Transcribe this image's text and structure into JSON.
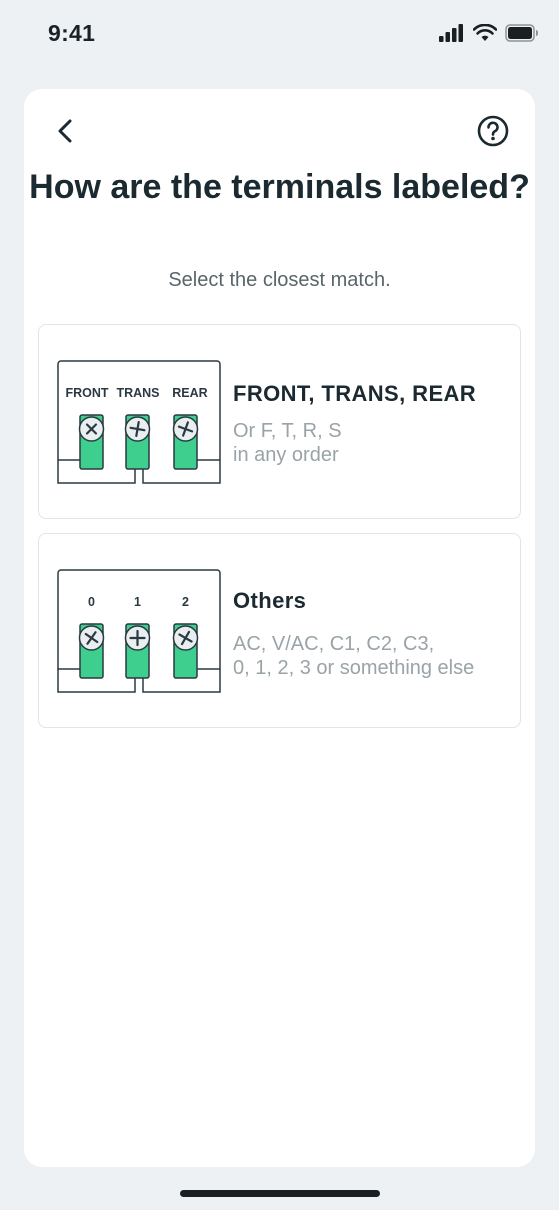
{
  "status_bar": {
    "time": "9:41"
  },
  "header": {
    "title": "How are the terminals labeled?",
    "subtitle": "Select the closest match."
  },
  "options": [
    {
      "title": "FRONT, TRANS, REAR",
      "desc_line1": "Or F, T, R, S",
      "desc_line2": "in any order",
      "terminal_labels": [
        "FRONT",
        "TRANS",
        "REAR"
      ]
    },
    {
      "title": "Others",
      "desc_line1": "AC, V/AC, C1, C2, C3,",
      "desc_line2": "0, 1, 2, 3 or something else",
      "terminal_labels": [
        "0",
        "1",
        "2"
      ]
    }
  ],
  "colors": {
    "accent": "#3ecf8e",
    "text_dark": "#1b2a30",
    "text_muted": "#9aa3a7"
  },
  "icons": [
    "back-chevron-icon",
    "help-question-icon",
    "signal-icon",
    "wifi-icon",
    "battery-icon"
  ]
}
